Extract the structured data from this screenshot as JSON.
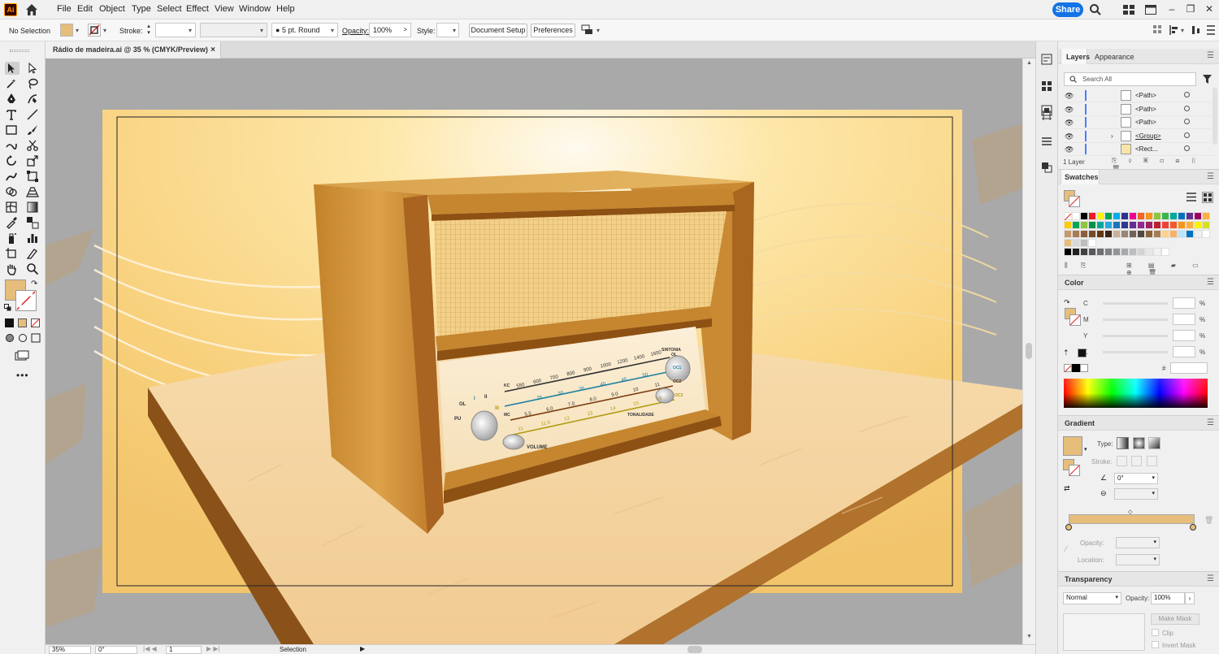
{
  "app": {
    "logo": "Ai"
  },
  "menu": [
    "File",
    "Edit",
    "Object",
    "Type",
    "Select",
    "Effect",
    "View",
    "Window",
    "Help"
  ],
  "header": {
    "share_label": "Share"
  },
  "control_bar": {
    "selection_label": "No Selection",
    "stroke_label": "Stroke:",
    "brush_value": "5 pt. Round",
    "opacity_label": "Opacity:",
    "opacity_value": "100%",
    "style_label": "Style:",
    "document_setup": "Document Setup",
    "preferences": "Preferences"
  },
  "document_tab": {
    "title": "Rádio de madeira.ai @ 35 % (CMYK/Preview)",
    "close": "×"
  },
  "status_bar": {
    "zoom": "35%",
    "rotation": "0°",
    "artboard": "1",
    "tool": "Selection"
  },
  "layers_panel": {
    "tabs": [
      "Layers",
      "Appearance"
    ],
    "search_placeholder": "Search All",
    "rows": [
      "<Path>",
      "<Path>",
      "<Path>",
      "<Group>",
      "<Rect..."
    ],
    "layer_count": "1 Layer"
  },
  "swatches_panel": {
    "title": "Swatches"
  },
  "color_panel": {
    "title": "Color",
    "channels": [
      "C",
      "M",
      "Y",
      "K"
    ],
    "percent": "%",
    "hex_symbol": "#"
  },
  "gradient_panel": {
    "title": "Gradient",
    "type_label": "Type:",
    "stroke_label": "Stroke:",
    "angle_value": "0°",
    "opacity_label": "Opacity:",
    "location_label": "Location:"
  },
  "transparency_panel": {
    "title": "Transparency",
    "blend_mode": "Normal",
    "opacity_label": "Opacity:",
    "opacity_value": "100%",
    "make_mask": "Make Mask",
    "clip": "Clip",
    "invert_mask": "Invert Mask"
  },
  "artwork": {
    "dial_labels": {
      "ol": "OL",
      "oc1": "OC1",
      "oc2": "OC2",
      "oc3": "OC3",
      "kc": "KC",
      "mc": "MC",
      "pu": "PU",
      "sintonia": "SINTONIA",
      "tonalidade": "TONALIDADE",
      "volume": "VOLUME",
      "band1": "I",
      "band2": "II",
      "band3": "III"
    },
    "scale_top": [
      "550",
      "600",
      "700",
      "800",
      "900",
      "1000",
      "1200",
      "1400",
      "1600"
    ],
    "scale_blue": [
      "25",
      "30",
      "35",
      "40",
      "45",
      "50"
    ],
    "scale_brown": [
      "5.5",
      "6.0",
      "7.0",
      "8.0",
      "9.0",
      "10",
      "11"
    ],
    "scale_yellow": [
      "11",
      "11.5",
      "12",
      "13",
      "14",
      "15",
      "16"
    ]
  },
  "colors": {
    "fill": "#e6bd7b",
    "accent": "#1473e6",
    "canvas_bg": "#a9a9a9"
  }
}
